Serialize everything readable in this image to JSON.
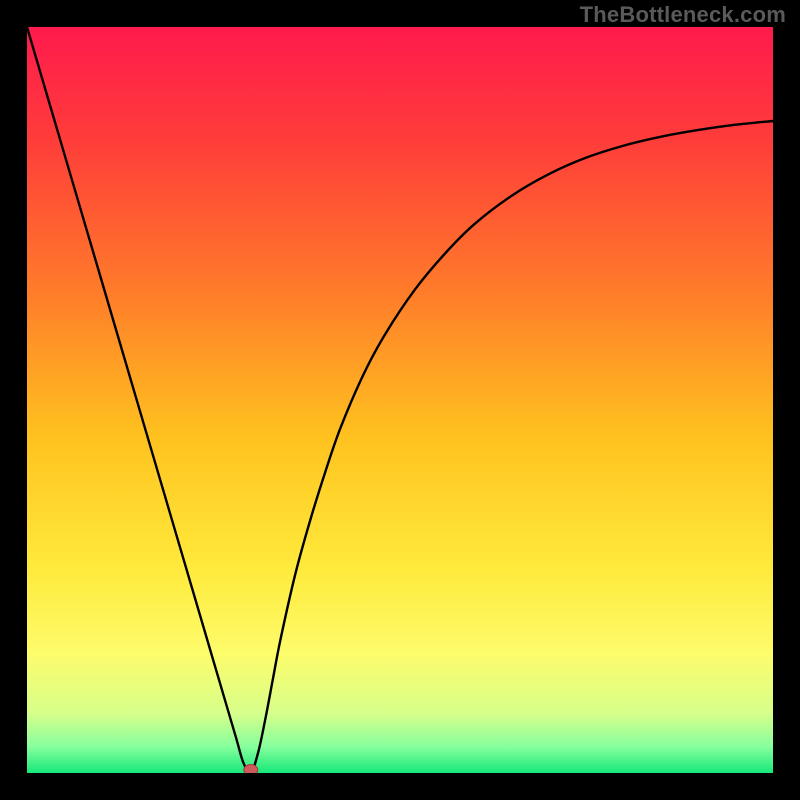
{
  "watermark": "TheBottleneck.com",
  "colors": {
    "bg": "#000000",
    "curve": "#000000",
    "marker_fill": "#cf5a5a",
    "marker_stroke": "#a53c3c"
  },
  "chart_data": {
    "type": "line",
    "title": "",
    "xlabel": "",
    "ylabel": "",
    "xlim": [
      0,
      100
    ],
    "ylim": [
      0,
      100
    ],
    "grid": false,
    "legend": false,
    "gradient_stops": [
      {
        "offset": 0.0,
        "color": "#ff1a4d"
      },
      {
        "offset": 0.15,
        "color": "#ff3c3a"
      },
      {
        "offset": 0.35,
        "color": "#ff7a2a"
      },
      {
        "offset": 0.55,
        "color": "#ffc21f"
      },
      {
        "offset": 0.72,
        "color": "#ffe93a"
      },
      {
        "offset": 0.84,
        "color": "#fdfc6b"
      },
      {
        "offset": 0.92,
        "color": "#d7ff8a"
      },
      {
        "offset": 0.965,
        "color": "#85ff9d"
      },
      {
        "offset": 1.0,
        "color": "#17e87a"
      }
    ],
    "series": [
      {
        "name": "bottleneck-curve",
        "x": [
          0,
          2,
          4,
          6,
          8,
          10,
          12,
          14,
          16,
          18,
          20,
          22,
          24,
          26,
          28,
          29,
          30,
          31,
          32,
          33,
          34,
          36,
          38,
          40,
          42,
          45,
          48,
          52,
          56,
          60,
          65,
          70,
          75,
          80,
          85,
          90,
          95,
          100
        ],
        "y": [
          100,
          93.2,
          86.4,
          79.6,
          72.8,
          66.0,
          59.2,
          52.4,
          45.6,
          38.8,
          32.0,
          25.2,
          18.4,
          11.6,
          4.8,
          1.4,
          0.0,
          2.8,
          7.5,
          12.8,
          18.0,
          26.8,
          34.0,
          40.4,
          46.2,
          53.2,
          58.8,
          64.8,
          69.6,
          73.6,
          77.4,
          80.3,
          82.5,
          84.1,
          85.3,
          86.2,
          86.9,
          87.4
        ]
      }
    ],
    "marker": {
      "x": 30,
      "y": 0
    },
    "annotations": []
  }
}
